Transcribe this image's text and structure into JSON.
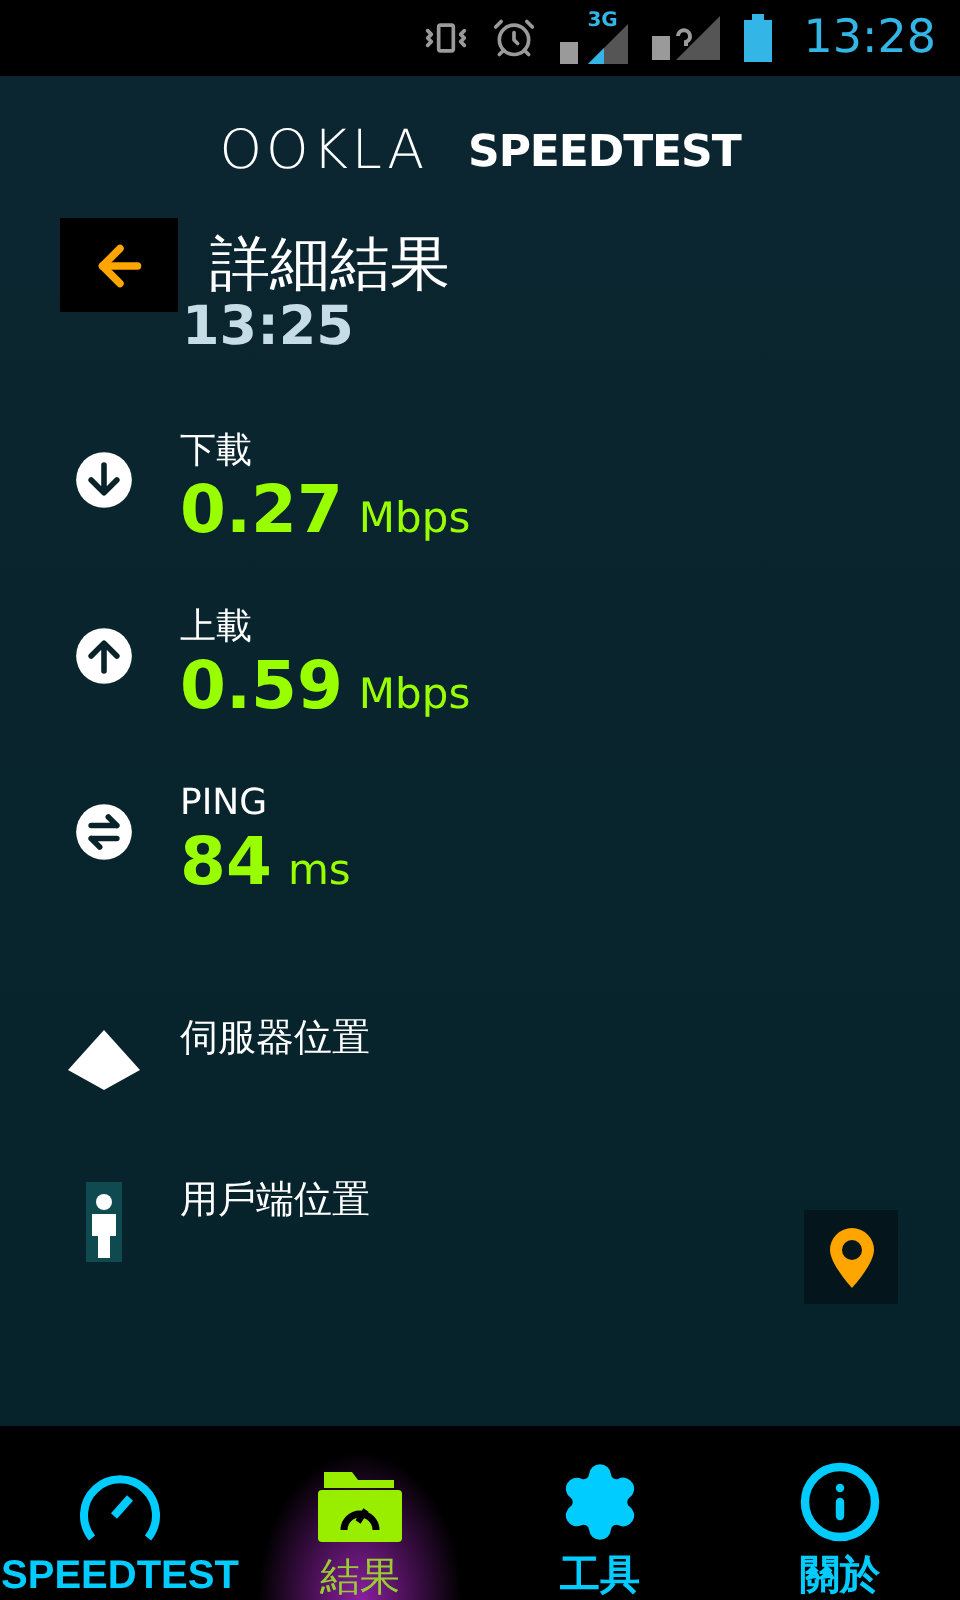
{
  "status_bar": {
    "network": "3G",
    "time": "13:28"
  },
  "logo": {
    "brand": "OOKLA",
    "product": "SPEEDTEST"
  },
  "header": {
    "title": "詳細結果",
    "time": "13:25"
  },
  "results": [
    {
      "kind": "download",
      "label": "下載",
      "value": "0.27",
      "unit": "Mbps"
    },
    {
      "kind": "upload",
      "label": "上載",
      "value": "0.59",
      "unit": "Mbps"
    },
    {
      "kind": "ping",
      "label": "PING",
      "value": "84",
      "unit": "ms"
    }
  ],
  "locations": [
    {
      "kind": "server",
      "label": "伺服器位置"
    },
    {
      "kind": "client",
      "label": "用戶端位置"
    }
  ],
  "nav": [
    {
      "kind": "speedtest",
      "label": "SPEEDTEST",
      "selected": false
    },
    {
      "kind": "results",
      "label": "結果",
      "selected": true
    },
    {
      "kind": "tools",
      "label": "工具",
      "selected": false
    },
    {
      "kind": "about",
      "label": "關於",
      "selected": false
    }
  ]
}
